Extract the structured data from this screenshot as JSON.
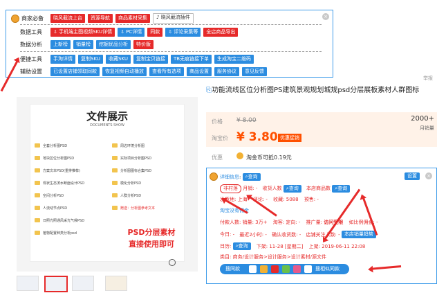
{
  "toolbar": {
    "rows": [
      {
        "label": "商家必备",
        "items": [
          "晓风截流上台",
          "资源导航",
          "商品素材采集",
          "晓风截流插件"
        ]
      },
      {
        "label": "数据工具",
        "items": [
          "手机端主图视频SKU详情",
          "PC详情",
          "同款",
          "评论采集等",
          "全店商品导出"
        ]
      },
      {
        "label": "数据分析",
        "items": [
          "上新榜",
          "销量榜",
          "挖掘优品分析",
          "特价版"
        ]
      },
      {
        "label": "便捷工具",
        "items": [
          "手淘详情",
          "复制SKU",
          "收藏SKU",
          "复制宝贝链接",
          "TB无痕链接下单",
          "生成淘宝二维码"
        ]
      },
      {
        "label": "辅助设置",
        "items": [
          "已设置店铺领取同款",
          "恢复视频自动播放",
          "查看所有选项",
          "商品设置",
          "服务协议",
          "意见反馈"
        ]
      }
    ],
    "close_icon": "close-icon"
  },
  "product_image": {
    "title": "文件展示",
    "subtitle": "DOCUMENTS SHOW",
    "left_list": [
      "全套分析图PSD",
      "地块区位分析图PSD",
      "方案文本PSD(重排推荐)",
      "现状生态滨水断面设计PSD",
      "空间分析PSD",
      "人流动节点PSD",
      "日照光照通风采光气候PSD",
      "植物配置种类分析psd"
    ],
    "right_list": [
      "周边环境分析图",
      "实际项目分析图PSD",
      "分析图图标合集PSD",
      "模化分析PSD",
      "人群分析PSD",
      "赠送：分析图参考文本"
    ],
    "promo_line1": "PSD分层素材",
    "promo_line2": "直接使用即可"
  },
  "report_link": "举报",
  "product_title": "功能流线区位分析图PS建筑景观规划城规psd分层展板素材人群图标",
  "price": {
    "label": "价格",
    "original": "¥ 8.00",
    "sales_count": "2000+",
    "sales_label": "月销量",
    "taobao_label": "淘宝价",
    "current": "¥ 3.80",
    "badge": "优惠促销"
  },
  "promo": {
    "label": "优惠",
    "text": "淘金币可抵0.19元"
  },
  "detail": {
    "title": "详细信息",
    "query_label": "查询",
    "settings_label": "设置",
    "tag_label": "非村落",
    "monthly_label": "月销: -",
    "buyers_label": "收货人数",
    "same_shop_label": "本店商品数",
    "origin_label": "发货地: 上海",
    "comments_label": "评论: -",
    "favorites_label": "收藏: 5088",
    "presale_label": "预售: -",
    "bonus_label": "淘宝没有佣金",
    "pay_label": "付款人数: 销量: 3万+",
    "channel_label": "淘客: 定向: -",
    "promote_label": "推广量:",
    "promote_value": "访问受限",
    "ratio_label": "如比例佣金: -",
    "today_label": "今日: -",
    "last2h_label": "最近2小时: -",
    "confirm_label": "确认收货数: -",
    "shop_follow_label": "店铺关注人数: -",
    "sales_chart_label": "本店销量趋势",
    "launch_label": "日历:",
    "down_label": "下架: 11-28 [星期二]",
    "up_label": "上架: 2019-06-11 22:08",
    "category_label": "类目: 商务/设计服务>设计服务>设计素材/源文件",
    "search_label": "搜同款",
    "image_search_label": "搜相似同款"
  },
  "colors": {
    "accent_blue": "#2b8ce0",
    "accent_red": "#e62a2a",
    "price_bg": "#fff2e8"
  }
}
